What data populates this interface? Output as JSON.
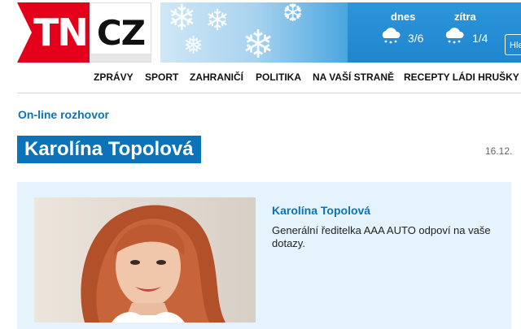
{
  "header": {
    "logo_left": "TN",
    "logo_right": "CZ",
    "weather": {
      "today_label": "dnes",
      "today_temp": "3/6",
      "tomorrow_label": "zítra",
      "tomorrow_temp": "1/4",
      "icon": "snow-cloud-icon"
    },
    "search_label": "Hle"
  },
  "nav": {
    "items": [
      "ZPRÁVY",
      "SPORT",
      "ZAHRANIČÍ",
      "POLITIKA",
      "NA VAŠÍ STRANĚ",
      "RECEPTY LÁDI HRUŠKY"
    ]
  },
  "content": {
    "section_label": "On-line rozhovor",
    "title": "Karolína Topolová",
    "date": "16.12.",
    "person_name": "Karolína Topolová",
    "person_description": "Generální ředitelka AAA AUTO odpoví na vaše dotazy."
  },
  "colors": {
    "brand_red": "#e4001b",
    "accent_blue": "#0d73b8",
    "panel_bg": "#e4f3fc"
  }
}
